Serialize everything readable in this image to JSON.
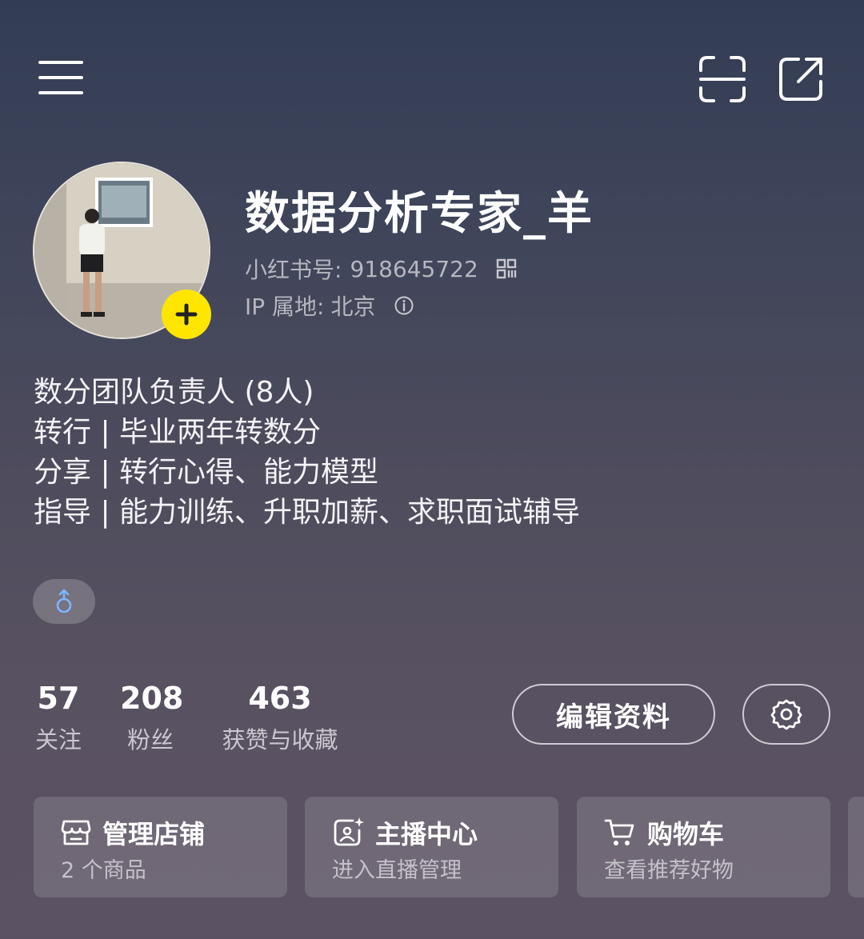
{
  "header": {
    "menu_icon": "hamburger-menu-icon",
    "scan_icon": "scan-icon",
    "share_icon": "share-icon"
  },
  "profile": {
    "nickname": "数据分析专家_羊",
    "red_id_label": "小红书号:",
    "red_id": "918645722",
    "ip_label": "IP 属地:",
    "ip_location": "北京",
    "add_icon": "plus-icon",
    "avatar_desc": "avatar-photo"
  },
  "bio": {
    "lines": [
      "数分团队负责人 (8人)",
      "转行 | 毕业两年转数分",
      "分享 | 转行心得、能力模型",
      "指导 | 能力训练、升职加薪、求职面试辅导"
    ]
  },
  "tags": {
    "gender_icon": "male-icon"
  },
  "stats": [
    {
      "num": "57",
      "label": "关注"
    },
    {
      "num": "208",
      "label": "粉丝"
    },
    {
      "num": "463",
      "label": "获赞与收藏"
    }
  ],
  "actions": {
    "edit_label": "编辑资料",
    "settings_icon": "gear-icon"
  },
  "cards": [
    {
      "title": "管理店铺",
      "sub": "2 个商品",
      "icon": "store-icon"
    },
    {
      "title": "主播中心",
      "sub": "进入直播管理",
      "icon": "live-host-icon"
    },
    {
      "title": "购物车",
      "sub": "查看推荐好物",
      "icon": "cart-icon"
    }
  ],
  "colors": {
    "accent_yellow": "#ffe600",
    "gender_blue": "#7cb6ff"
  }
}
